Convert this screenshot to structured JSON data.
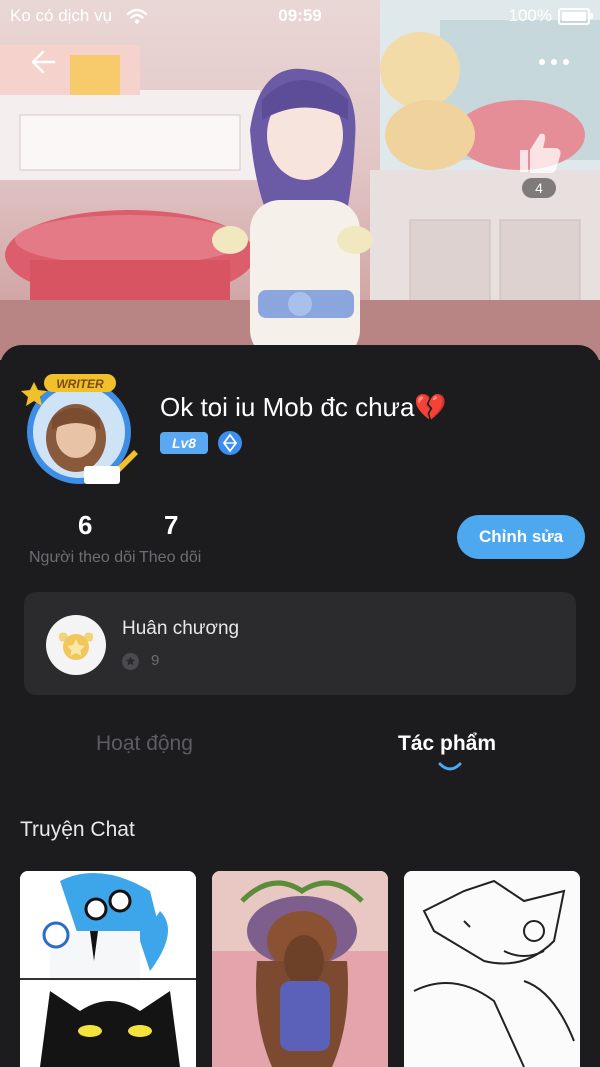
{
  "status_bar": {
    "carrier": "Ko có dịch vụ",
    "time": "09:59",
    "battery": "100%"
  },
  "header": {
    "like_count": "4"
  },
  "profile": {
    "username": "Ok toi iu Mob đc chưa💔",
    "level": "Lv8",
    "avatar_badge": "WRITER",
    "followers_count": "6",
    "followers_label": "Người theo dõi",
    "following_count": "7",
    "following_label": "Theo dõi",
    "edit_button_label": "Chỉnh sửa"
  },
  "medals": {
    "title": "Huân chương",
    "count": "9"
  },
  "tabs": [
    {
      "label": "Hoạt động",
      "active": false
    },
    {
      "label": "Tác phẩm",
      "active": true
    }
  ],
  "section": {
    "title": "Truyện Chat"
  },
  "colors": {
    "accent": "#4da8f0",
    "background": "#1c1c1e",
    "card": "#2b2b2e",
    "muted_text": "#6e6e72"
  }
}
